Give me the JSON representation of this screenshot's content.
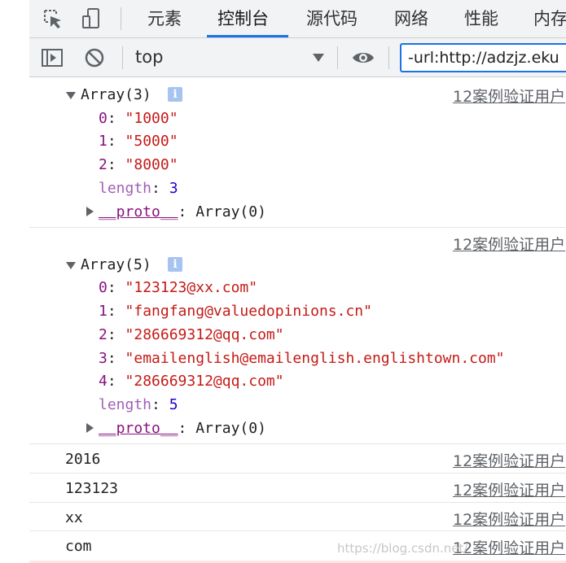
{
  "tabs": [
    "元素",
    "控制台",
    "源代码",
    "网络",
    "性能",
    "内存"
  ],
  "active_tab": "控制台",
  "toolbar": {
    "context": "top",
    "filter_value": "-url:http://adzjz.eku"
  },
  "source_link": "12案例验证用户",
  "group1": {
    "header": "Array(3)",
    "items": [
      {
        "index": "0",
        "value": "\"1000\""
      },
      {
        "index": "1",
        "value": "\"5000\""
      },
      {
        "index": "2",
        "value": "\"8000\""
      }
    ],
    "length_key": "length",
    "length_value": "3",
    "proto_key": "__proto__",
    "proto_value": "Array(0)"
  },
  "group2": {
    "header": "Array(5)",
    "items": [
      {
        "index": "0",
        "value": "\"123123@xx.com\""
      },
      {
        "index": "1",
        "value": "\"fangfang@valuedopinions.cn\""
      },
      {
        "index": "2",
        "value": "\"286669312@qq.com\""
      },
      {
        "index": "3",
        "value": "\"emailenglish@emailenglish.englishtown.com\""
      },
      {
        "index": "4",
        "value": "\"286669312@qq.com\""
      }
    ],
    "length_key": "length",
    "length_value": "5",
    "proto_key": "__proto__",
    "proto_value": "Array(0)"
  },
  "logs": [
    "2016",
    "123123",
    "xx",
    "com"
  ],
  "watermark": "https://blog.csdn.net/"
}
